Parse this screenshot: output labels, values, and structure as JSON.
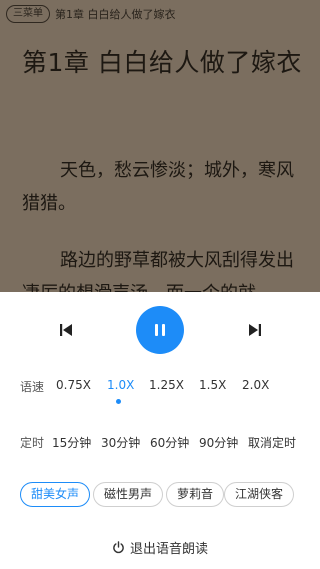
{
  "reader": {
    "menu_label": "三菜单",
    "header_chapter": "第1章 白白给人做了嫁衣",
    "chapter_title": "第1章 白白给人做了嫁衣",
    "paragraphs": [
      "天色，愁云惨淡；城外，寒风猎猎。",
      "路边的野草都被大风刮得发出凄厉的想滑声汤，而一个的就"
    ]
  },
  "player": {
    "prev_icon": "skip-previous-icon",
    "play_pause_icon": "pause-icon",
    "next_icon": "skip-next-icon",
    "accent_color": "#1d8cf8"
  },
  "speed": {
    "label": "语速",
    "options": [
      "0.75X",
      "1.0X",
      "1.25X",
      "1.5X",
      "2.0X"
    ],
    "selected": "1.0X"
  },
  "timer": {
    "label": "定时",
    "options": [
      "15分钟",
      "30分钟",
      "60分钟",
      "90分钟",
      "取消定时"
    ]
  },
  "voices": {
    "options": [
      "甜美女声",
      "磁性男声",
      "萝莉音",
      "江湖侠客"
    ],
    "selected": "甜美女声"
  },
  "exit": {
    "label": "退出语音朗读",
    "icon": "power-icon"
  }
}
